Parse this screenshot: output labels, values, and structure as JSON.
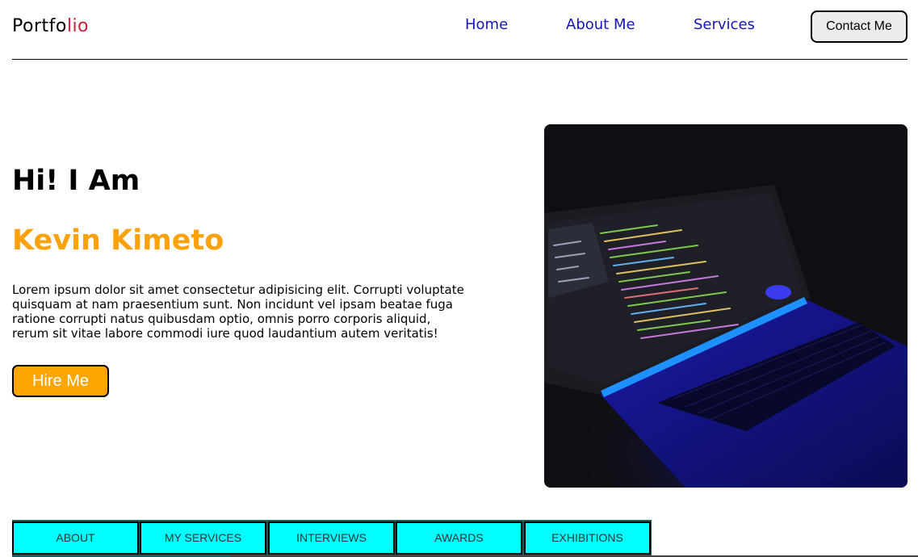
{
  "header": {
    "logo_main": "Portfo",
    "logo_accent": "lio",
    "nav": {
      "home": "Home",
      "about": "About Me",
      "services": "Services"
    },
    "contact_label": "Contact Me"
  },
  "hero": {
    "greeting": "Hi! I Am",
    "name": "Kevin Kimeto",
    "bio": "Lorem ipsum dolor sit amet consectetur adipisicing elit. Corrupti voluptate quisquam at nam praesentium sunt. Non incidunt vel ipsam beatae fuga ratione corrupti natus quibusdam optio, omnis porro corporis aliquid, rerum sit vitae labore commodi iure quod laudantium autem veritatis!",
    "hire_label": "Hire Me"
  },
  "tabs": {
    "about": "ABOUT",
    "services": "MY SERVICES",
    "interviews": "INTERVIEWS",
    "awards": "AWARDS",
    "exhibitions": "EXHIBITIONS"
  },
  "colors": {
    "accent_orange": "#ffa500",
    "nav_blue": "#1515b8",
    "logo_red": "#d0203a",
    "tab_cyan": "#00ffff"
  }
}
